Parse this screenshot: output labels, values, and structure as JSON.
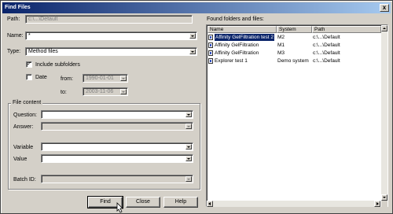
{
  "window": {
    "title": "Find Files",
    "close_glyph": "x"
  },
  "path": {
    "label": "Path:",
    "value": "c:\\...\\Default"
  },
  "name": {
    "label": "Name:",
    "value": "*"
  },
  "type": {
    "label": "Type:",
    "value": "Method files"
  },
  "include_subfolders": {
    "label": "Include subfolders",
    "checked": true,
    "mark": "✓"
  },
  "date": {
    "label": "Date",
    "checked": false,
    "from_label": "from:",
    "from_value": "1990-01-01",
    "to_label": "to:",
    "to_value": "2003-11-06"
  },
  "file_content": {
    "title": "File content",
    "question_label": "Question:",
    "answer_label": "Answer:",
    "variable_label": "Variable",
    "value_label": "Value",
    "batch_label": "Batch ID:"
  },
  "buttons": {
    "find": "Find",
    "close": "Close",
    "help": "Help"
  },
  "results": {
    "title": "Found folders and files:",
    "columns": [
      "Name",
      "System",
      "Path"
    ],
    "rows": [
      {
        "name": "Affinity GelFiltration test 2",
        "system": "M2",
        "path": "c:\\...\\Default",
        "selected": true
      },
      {
        "name": "Affinity GelFiltration",
        "system": "M1",
        "path": "c:\\...\\Default",
        "selected": false
      },
      {
        "name": "Affinity GelFiltration",
        "system": "M3",
        "path": "c:\\...\\Default",
        "selected": false
      },
      {
        "name": "Explorer test 1",
        "system": "Demo system",
        "path": "c:\\...\\Default",
        "selected": false
      }
    ]
  },
  "colors": {
    "titlebar": "#0a246a",
    "face": "#d4d0c8",
    "selection": "#0a246a"
  }
}
